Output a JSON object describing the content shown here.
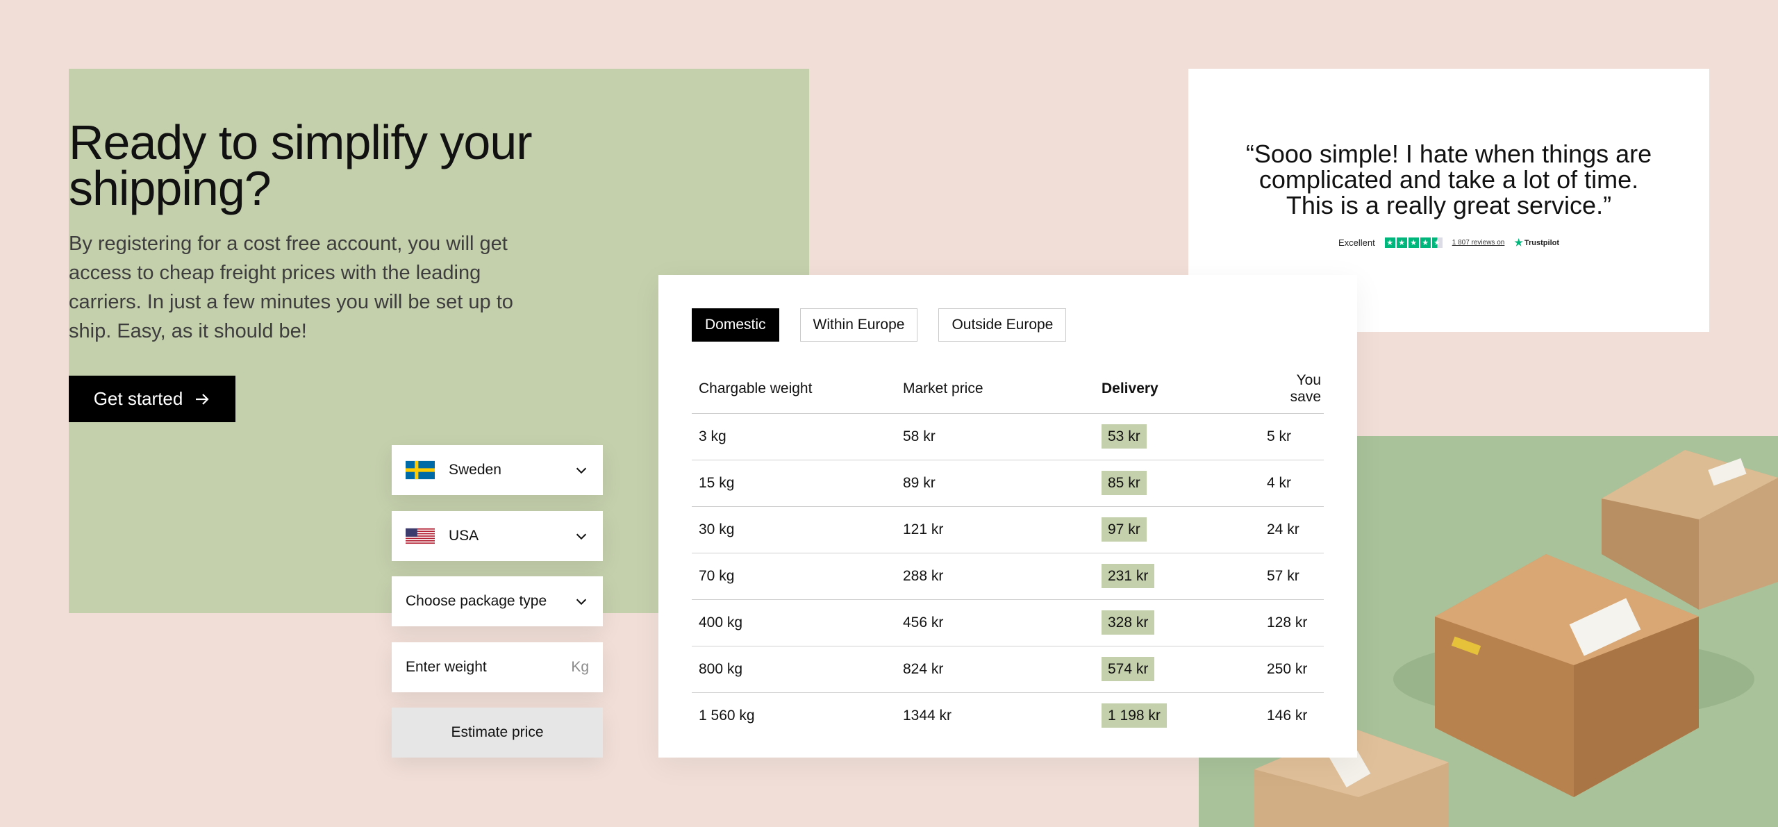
{
  "hero": {
    "title": "Ready to simplify your shipping?",
    "description": "By registering for a cost free account, you will get access to cheap freight prices with the leading carriers. In just a few minutes you will be set up to ship. Easy, as it should be!",
    "cta_label": "Get started"
  },
  "form": {
    "from_country": "Sweden",
    "to_country": "USA",
    "package_type_placeholder": "Choose package type",
    "weight_placeholder": "Enter weight",
    "weight_unit": "Kg",
    "estimate_label": "Estimate price"
  },
  "review": {
    "quote": "“Sooo simple! I hate when things are complicated and take a lot of time. This is a really great service.”",
    "rating_label": "Excellent",
    "stars": 4.5,
    "reviews_link": "1 807 reviews on",
    "brand": "Trustpilot"
  },
  "pricing": {
    "tabs": [
      {
        "label": "Domestic",
        "active": true
      },
      {
        "label": "Within Europe",
        "active": false
      },
      {
        "label": "Outside Europe",
        "active": false
      }
    ],
    "columns": [
      "Chargable weight",
      "Market price",
      "Delivery",
      "You save"
    ],
    "rows": [
      {
        "weight": "3 kg",
        "market": "58 kr",
        "delivery": "53 kr",
        "save": "5 kr"
      },
      {
        "weight": "15 kg",
        "market": "89 kr",
        "delivery": "85 kr",
        "save": "4 kr"
      },
      {
        "weight": "30 kg",
        "market": "121 kr",
        "delivery": "97 kr",
        "save": "24 kr"
      },
      {
        "weight": "70 kg",
        "market": "288 kr",
        "delivery": "231 kr",
        "save": "57 kr"
      },
      {
        "weight": "400 kg",
        "market": "456 kr",
        "delivery": "328 kr",
        "save": "128 kr"
      },
      {
        "weight": "800 kg",
        "market": "824 kr",
        "delivery": "574 kr",
        "save": "250 kr"
      },
      {
        "weight": "1 560 kg",
        "market": "1344 kr",
        "delivery": "1 198 kr",
        "save": "146 kr"
      }
    ]
  },
  "colors": {
    "background": "#f0ded7",
    "hero_green": "#c4cfac",
    "trustpilot_green": "#00b67a"
  }
}
